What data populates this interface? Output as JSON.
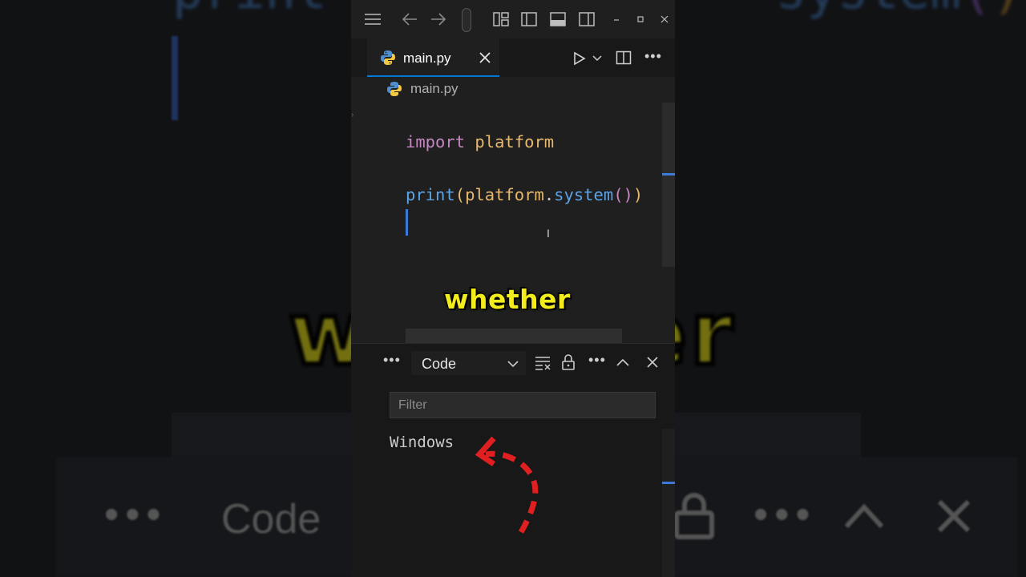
{
  "editor": {
    "tab_name": "main.py",
    "breadcrumb_file": "main.py",
    "line1_keyword": "import",
    "line1_module": "platform",
    "line3_fn": "print",
    "line3_paren_open": "(",
    "line3_obj": "platform",
    "line3_dot": ".",
    "line3_method": "system",
    "line3_inner_parens": "()",
    "line3_paren_close": ")"
  },
  "caption": {
    "text": "whether"
  },
  "panel": {
    "dropdown_value": "Code",
    "filter_placeholder": "Filter",
    "output_text": "Windows"
  },
  "background": {
    "code_fragment_left": "print",
    "code_fragment_right": "system",
    "caption_left": "w",
    "caption_right": "er",
    "bar_label": "Code"
  },
  "colors": {
    "keyword": "#c586c0",
    "module": "#e8b86d",
    "function": "#5ca3e6",
    "caption": "#f2ec1c",
    "accent": "#0078d4",
    "arrow": "#e02020"
  },
  "icons": {
    "titlebar": [
      "menu-icon",
      "back-arrow-icon",
      "forward-arrow-icon",
      "customize-layout-icon",
      "toggle-sidebar-icon",
      "toggle-panel-icon",
      "toggle-secondary-sidebar-icon",
      "minimize-icon",
      "maximize-icon",
      "close-window-icon"
    ],
    "editor_actions": [
      "run-icon",
      "run-dropdown-icon",
      "split-editor-icon",
      "more-actions-icon"
    ],
    "panel_actions": [
      "panel-more-icon",
      "clear-output-icon",
      "lock-scroll-icon",
      "panel-more-actions-icon",
      "maximize-panel-icon",
      "close-panel-icon"
    ]
  }
}
